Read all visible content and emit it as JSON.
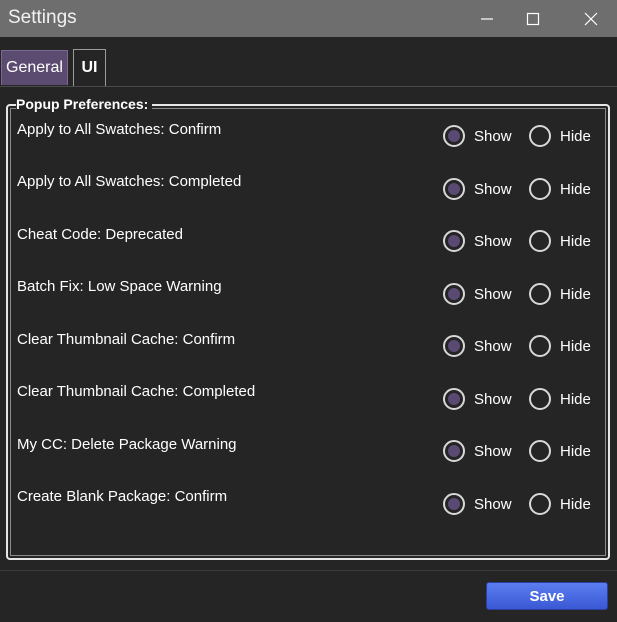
{
  "window": {
    "title": "Settings",
    "buttons": [
      "minimize-icon",
      "maximize-icon",
      "close-icon"
    ]
  },
  "tabs": [
    {
      "label": "General",
      "active": false
    },
    {
      "label": "UI",
      "active": true
    }
  ],
  "group": {
    "legend": "Popup Preferences:"
  },
  "options": {
    "show": "Show",
    "hide": "Hide"
  },
  "preferences": [
    {
      "label": "Apply to All Swatches: Confirm",
      "selected": "Show"
    },
    {
      "label": "Apply to All Swatches: Completed",
      "selected": "Show"
    },
    {
      "label": "Cheat Code: Deprecated",
      "selected": "Show"
    },
    {
      "label": "Batch Fix: Low Space Warning",
      "selected": "Show"
    },
    {
      "label": "Clear Thumbnail Cache: Confirm",
      "selected": "Show"
    },
    {
      "label": "Clear Thumbnail Cache: Completed",
      "selected": "Show"
    },
    {
      "label": "My CC: Delete Package Warning",
      "selected": "Show"
    },
    {
      "label": "Create Blank Package: Confirm",
      "selected": "Show"
    }
  ],
  "footer": {
    "save_label": "Save"
  },
  "colors": {
    "accent": "#5a4a73",
    "save_button": "#4a6ae6",
    "title_bar": "#6e6e6e",
    "background": "#252525"
  }
}
